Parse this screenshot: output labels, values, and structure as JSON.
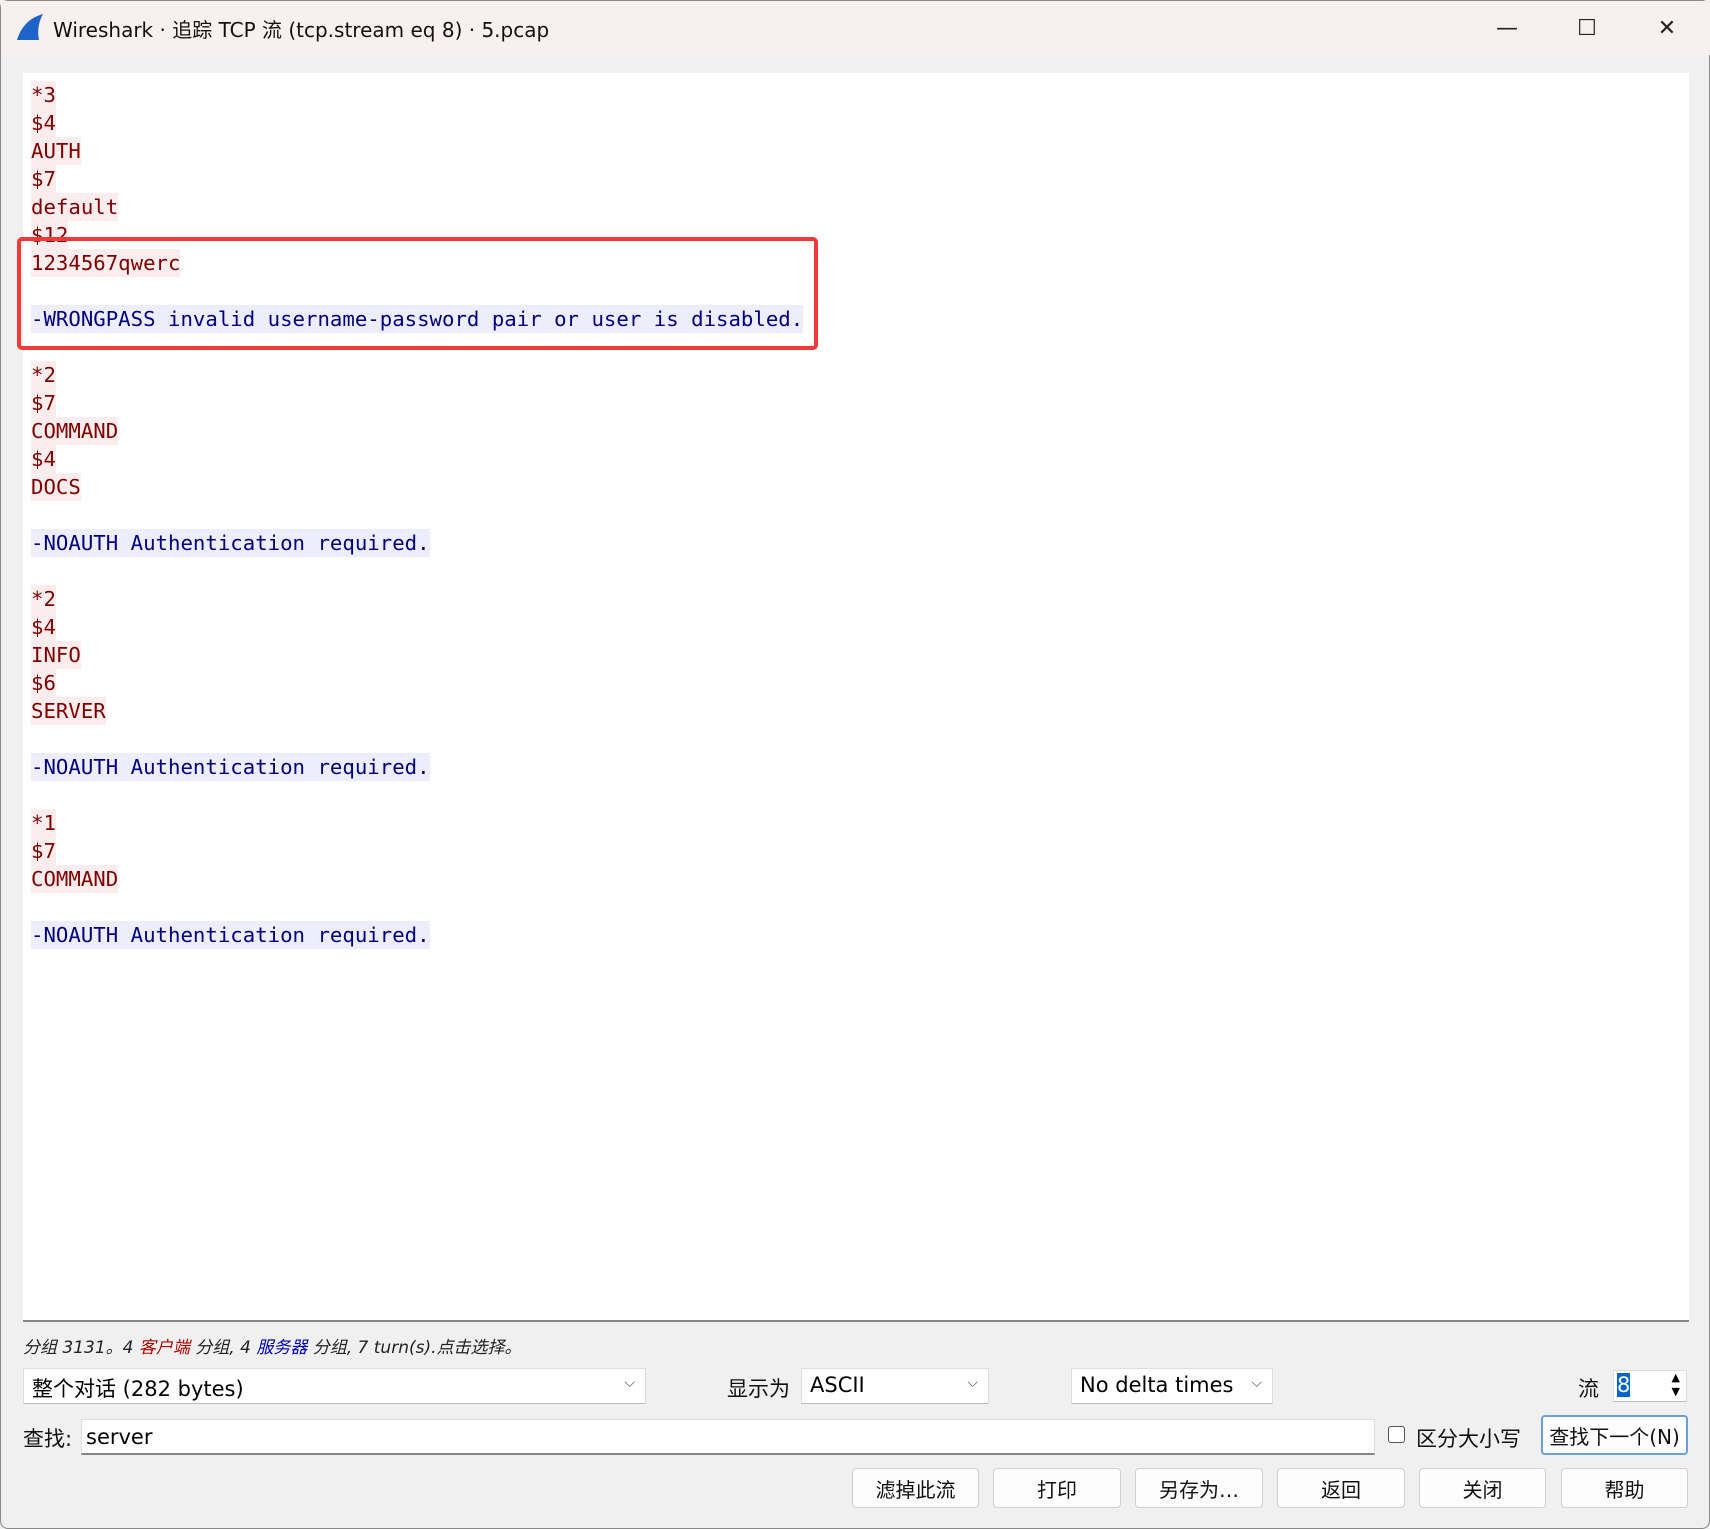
{
  "window": {
    "title": "Wireshark · 追踪 TCP 流 (tcp.stream eq 8) · 5.pcap",
    "minimize": "—",
    "maximize": "☐",
    "close": "✕"
  },
  "stream_lines": [
    {
      "side": "client",
      "text": "*3"
    },
    {
      "side": "client",
      "text": "$4"
    },
    {
      "side": "client",
      "text": "AUTH"
    },
    {
      "side": "client",
      "text": "$7"
    },
    {
      "side": "client",
      "text": "default"
    },
    {
      "side": "client",
      "text": "$12"
    },
    {
      "side": "client",
      "text": "1234567qwerc"
    },
    {
      "side": "blank",
      "text": ""
    },
    {
      "side": "server",
      "text": "-WRONGPASS invalid username-password pair or user is disabled."
    },
    {
      "side": "blank",
      "text": ""
    },
    {
      "side": "client",
      "text": "*2"
    },
    {
      "side": "client",
      "text": "$7"
    },
    {
      "side": "client",
      "text": "COMMAND"
    },
    {
      "side": "client",
      "text": "$4"
    },
    {
      "side": "client",
      "text": "DOCS"
    },
    {
      "side": "blank",
      "text": ""
    },
    {
      "side": "server",
      "text": "-NOAUTH Authentication required."
    },
    {
      "side": "blank",
      "text": ""
    },
    {
      "side": "client",
      "text": "*2"
    },
    {
      "side": "client",
      "text": "$4"
    },
    {
      "side": "client",
      "text": "INFO"
    },
    {
      "side": "client",
      "text": "$6"
    },
    {
      "side": "client",
      "text": "SERVER"
    },
    {
      "side": "blank",
      "text": ""
    },
    {
      "side": "server",
      "text": "-NOAUTH Authentication required."
    },
    {
      "side": "blank",
      "text": ""
    },
    {
      "side": "client",
      "text": "*1"
    },
    {
      "side": "client",
      "text": "$7"
    },
    {
      "side": "client",
      "text": "COMMAND"
    },
    {
      "side": "blank",
      "text": ""
    },
    {
      "side": "server",
      "text": "-NOAUTH Authentication required."
    }
  ],
  "status": {
    "p1": "分组 3131。4 ",
    "client": "客户端",
    "p2": " 分组, 4 ",
    "server": "服务器",
    "p3": " 分组, 7 turn(s).点击选择。"
  },
  "controls": {
    "conversation": "整个对话 (282 bytes)",
    "show_as_label": "显示为",
    "show_as": "ASCII",
    "delta": "No delta times",
    "stream_label": "流",
    "stream_value": "8",
    "find_label": "查找:",
    "find_value": "server",
    "case_label": "区分大小写",
    "find_next": "查找下一个(N)"
  },
  "buttons": [
    "滤掉此流",
    "打印",
    "另存为…",
    "返回",
    "关闭",
    "帮助"
  ],
  "colors": {
    "client_fg": "#7f0000",
    "client_bg": "#fbeded",
    "server_fg": "#00007f",
    "server_bg": "#ededfb",
    "highlight": "#f03a3a"
  }
}
